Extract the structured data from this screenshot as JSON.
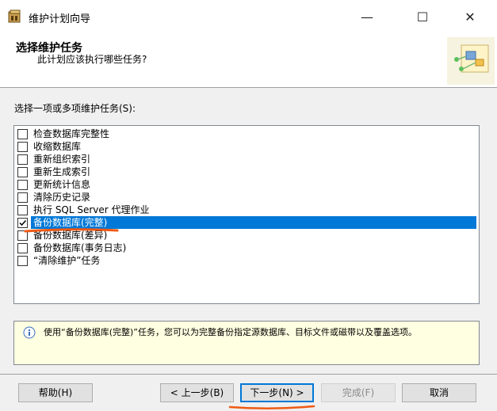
{
  "window": {
    "title": "维护计划向导",
    "minimize_glyph": "—",
    "maximize_glyph": "☐",
    "close_glyph": "✕"
  },
  "header": {
    "title": "选择维护任务",
    "subtitle": "此计划应该执行哪些任务?"
  },
  "task_section_label": "选择一项或多项维护任务(S):",
  "tasks": [
    {
      "label": "检查数据库完整性",
      "checked": false,
      "selected": false
    },
    {
      "label": "收缩数据库",
      "checked": false,
      "selected": false
    },
    {
      "label": "重新组织索引",
      "checked": false,
      "selected": false
    },
    {
      "label": "重新生成索引",
      "checked": false,
      "selected": false
    },
    {
      "label": "更新统计信息",
      "checked": false,
      "selected": false
    },
    {
      "label": "清除历史记录",
      "checked": false,
      "selected": false
    },
    {
      "label": "执行 SQL Server 代理作业",
      "checked": false,
      "selected": false
    },
    {
      "label": "备份数据库(完整)",
      "checked": true,
      "selected": true
    },
    {
      "label": "备份数据库(差异)",
      "checked": false,
      "selected": false
    },
    {
      "label": "备份数据库(事务日志)",
      "checked": false,
      "selected": false
    },
    {
      "label": "“清除维护”任务",
      "checked": false,
      "selected": false
    }
  ],
  "description": "使用“备份数据库(完整)”任务，您可以为完整备份指定源数据库、目标文件或磁带以及覆盖选项。",
  "buttons": {
    "help": "帮助(H)",
    "back": "< 上一步(B)",
    "next": "下一步(N) >",
    "finish": "完成(F)",
    "cancel": "取消"
  },
  "colors": {
    "selection": "#0078d7",
    "annotation": "#f05a14",
    "info_bg": "#ffffe1"
  }
}
